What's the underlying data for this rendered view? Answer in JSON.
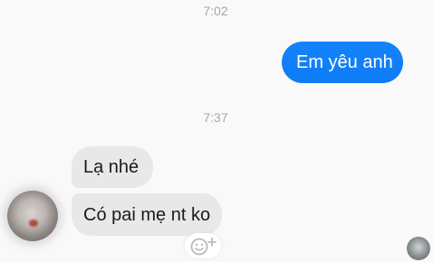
{
  "timestamps": {
    "first": "7:02",
    "second": "7:37"
  },
  "messages": {
    "outgoing_1": "Em yêu anh",
    "incoming_1": "Lạ nhé",
    "incoming_2": "Có pai mẹ nt ko"
  },
  "icons": {
    "reaction": "add-reaction-icon",
    "sender_avatar": "avatar",
    "seen_avatar": "avatar"
  },
  "colors": {
    "outgoing_bubble": "#1584fb",
    "incoming_bubble": "#e8e8e8",
    "timestamp": "#a7a7a7"
  }
}
